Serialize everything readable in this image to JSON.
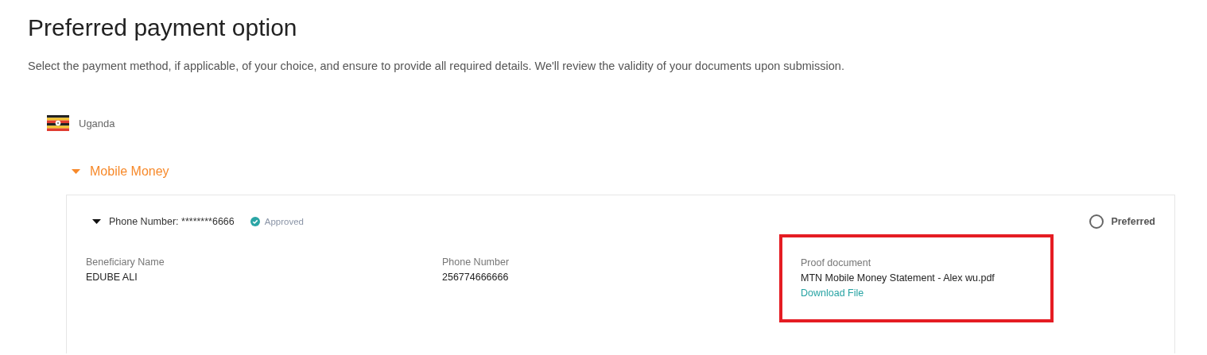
{
  "title": "Preferred payment option",
  "description": "Select the payment method, if applicable, of your choice, and ensure to provide all required details. We'll review the validity of your documents upon submission.",
  "country": {
    "name": "Uganda"
  },
  "method": {
    "label": "Mobile Money",
    "expanded": true
  },
  "account": {
    "label": "Phone Number:",
    "masked": "********6666",
    "status": "Approved",
    "expanded": true,
    "preferred": false,
    "preferred_label": "Preferred",
    "fields": [
      {
        "label": "Beneficiary Name",
        "value": "EDUBE ALI"
      },
      {
        "label": "Phone Number",
        "value": "256774666666"
      }
    ],
    "proof": {
      "label": "Proof document",
      "filename": "MTN Mobile Money Statement - Alex wu.pdf",
      "link": "Download File",
      "highlighted": true
    }
  }
}
